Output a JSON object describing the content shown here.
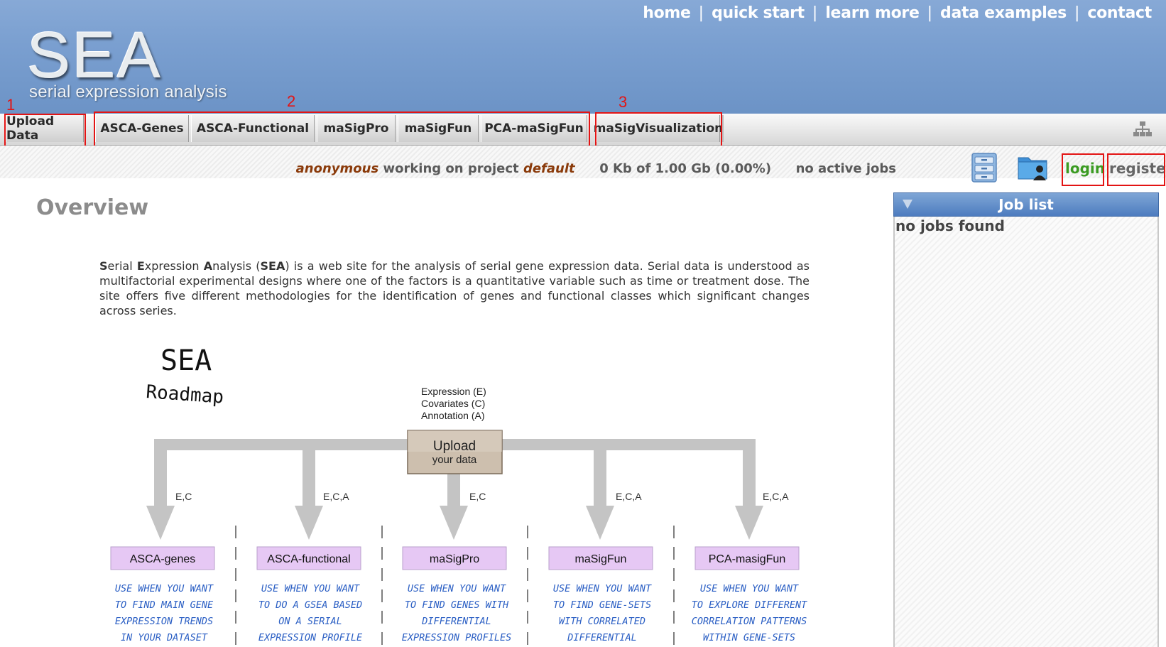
{
  "topnav": {
    "items": [
      "home",
      "quick start",
      "learn more",
      "data examples",
      "contact"
    ],
    "separator": "|"
  },
  "logo": {
    "title": "SEA",
    "subtitle": "serial expression analysis"
  },
  "tabs": [
    "Upload Data",
    "ASCA-Genes",
    "ASCA-Functional",
    "maSigPro",
    "maSigFun",
    "PCA-maSigFun",
    "maSigVisualization"
  ],
  "annotations": [
    "1",
    "2",
    "3"
  ],
  "status": {
    "user": "anonymous",
    "working_on": "working on project",
    "project": "default",
    "quota": "0 Kb of 1.00 Gb (0.00%)",
    "jobs": "no active jobs",
    "login": "login",
    "register": "register"
  },
  "overview": {
    "title": "Overview",
    "intro_parts": [
      "S",
      "erial ",
      "E",
      "xpression ",
      "A",
      "nalysis (",
      "SEA",
      ") is a web site for the analysis of serial gene expression data. Serial data is understood as multifactorial experimental designs where one of the factors is a quantitative variable such as time or treatment dose. The site offers five different methodologies for the identification of genes and functional classes which significant changes across series."
    ]
  },
  "joblist": {
    "title": "Job list",
    "empty": "no jobs found"
  },
  "roadmap": {
    "title": "SEA",
    "subtitle": "Roadmap",
    "inputs": [
      "Expression (E)",
      "Covariates (C)",
      "Annotation (A)"
    ],
    "upload_label": "Upload",
    "upload_sub": "your data",
    "branch_labels": [
      "E,C",
      "E,C,A",
      "E,C",
      "E,C,A",
      "E,C,A"
    ],
    "methods": [
      "ASCA-genes",
      "ASCA-functional",
      "maSigPro",
      "maSigFun",
      "PCA-masigFun"
    ],
    "descriptions": [
      [
        "USE WHEN YOU WANT",
        "TO FIND MAIN GENE",
        "EXPRESSION TRENDS",
        "IN YOUR DATASET"
      ],
      [
        "USE WHEN YOU WANT",
        "TO DO A GSEA BASED",
        "ON A SERIAL",
        "EXPRESSION PROFILE"
      ],
      [
        "USE WHEN YOU WANT",
        "TO FIND GENES WITH",
        "DIFFERENTIAL",
        "EXPRESSION PROFILES"
      ],
      [
        "USE WHEN YOU WANT",
        "TO FIND GENE-SETS",
        "WITH CORRELATED",
        "DIFFERENTIAL"
      ],
      [
        "USE WHEN YOU WANT",
        "TO EXPLORE DIFFERENT",
        "CORRELATION PATTERNS",
        "WITHIN GENE-SETS"
      ]
    ]
  },
  "colors": {
    "header": "#7a9fd0",
    "highlight_red": "#e31414",
    "login_green": "#3b9b22",
    "method_box": "#e6c8f4",
    "handwriting_blue": "#2b5fc4",
    "arrow_gray": "#c4c4c4"
  },
  "icons": [
    "sitemap-icon",
    "file-cabinet-icon",
    "user-folder-icon",
    "collapse-triangle-icon"
  ]
}
